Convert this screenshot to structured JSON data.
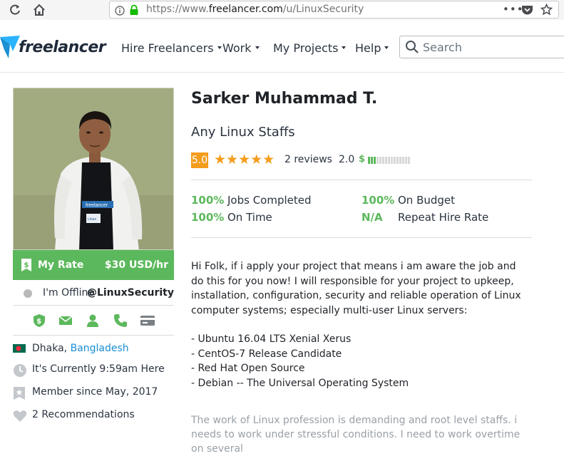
{
  "browser": {
    "url_prefix": "https://www.",
    "url_host": "freelancer.com",
    "url_path": "/u/LinuxSecurity"
  },
  "header": {
    "logo": "freelancer",
    "nav": [
      {
        "label": "Hire Freelancers"
      },
      {
        "label": "Work"
      },
      {
        "label": "My Projects"
      },
      {
        "label": "Help"
      }
    ],
    "search_placeholder": "Search"
  },
  "profile": {
    "rate_label": "My Rate",
    "rate_value": "$30 USD/hr",
    "status": "I'm Offline",
    "username": "@LinuxSecurity",
    "location_city": "Dhaka,",
    "location_country": "Bangladesh",
    "local_time": "It's Currently 9:59am Here",
    "member_since": "Member since May, 2017",
    "recommendations": "2 Recommendations",
    "photo_shirt_text": "freelancer",
    "photo_badge_text": "Linux"
  },
  "main": {
    "name": "Sarker Muhammad T.",
    "tagline": "Any Linux Staffs",
    "rating": "5.0",
    "reviews": "2 reviews",
    "earnings_score": "2.0",
    "earnings_bar_level": 0.2,
    "stats": [
      {
        "pct": "100%",
        "label": "Jobs Completed"
      },
      {
        "pct": "100%",
        "label": "On Budget"
      },
      {
        "pct": "100%",
        "label": "On Time"
      },
      {
        "pct": "N/A",
        "label": "Repeat Hire Rate"
      }
    ],
    "bio_paragraph": "Hi Folk, if i apply your project that means i am aware the job and do this for you now! I will responsible for your project to upkeep, installation, configuration, security and reliable operation of Linux computer systems; especially multi-user Linux servers:",
    "bio_list": [
      "- Ubuntu 16.04 LTS Xenial Xerus",
      "- CentOS-7 Release Candidate",
      "- Red Hat Open Source",
      "- Debian -- The Universal Operating System"
    ],
    "bio_more": "The work of Linux profession is demanding and root level staffs. i needs to work under stressful conditions. I need to work overtime on several"
  },
  "colors": {
    "brand_green": "#5cb85c",
    "star_orange": "#f49c1b",
    "link_blue": "#1a8fd4",
    "logo_blue": "#29b2fe"
  }
}
